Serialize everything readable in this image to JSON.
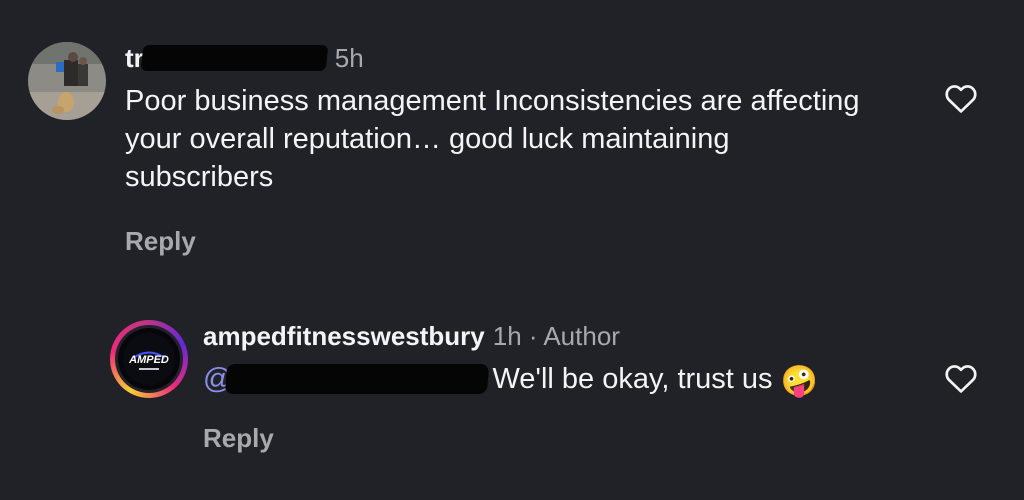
{
  "comments": [
    {
      "username": "tr",
      "time": "5h",
      "text": "Poor business management Inconsistencies are affecting your overall reputation… good luck maintaining subscribers",
      "reply_label": "Reply",
      "like_icon": "heart-outline-icon"
    },
    {
      "username": "ampedfitnesswestbury",
      "time": "1h",
      "separator": " · ",
      "author_badge": "Author",
      "mention_prefix": "@",
      "text": "We'll be okay, trust us",
      "emoji": "🤪",
      "reply_label": "Reply",
      "like_icon": "heart-outline-icon",
      "avatar_logo_text": "AMPED",
      "avatar_ring_colors": [
        "#f9ce34",
        "#ee2a7b",
        "#6228d7"
      ]
    }
  ],
  "colors": {
    "background": "#212227",
    "text_primary": "#f4f4f6",
    "text_secondary": "#a8a8ad",
    "mention": "#8c8fe8"
  }
}
